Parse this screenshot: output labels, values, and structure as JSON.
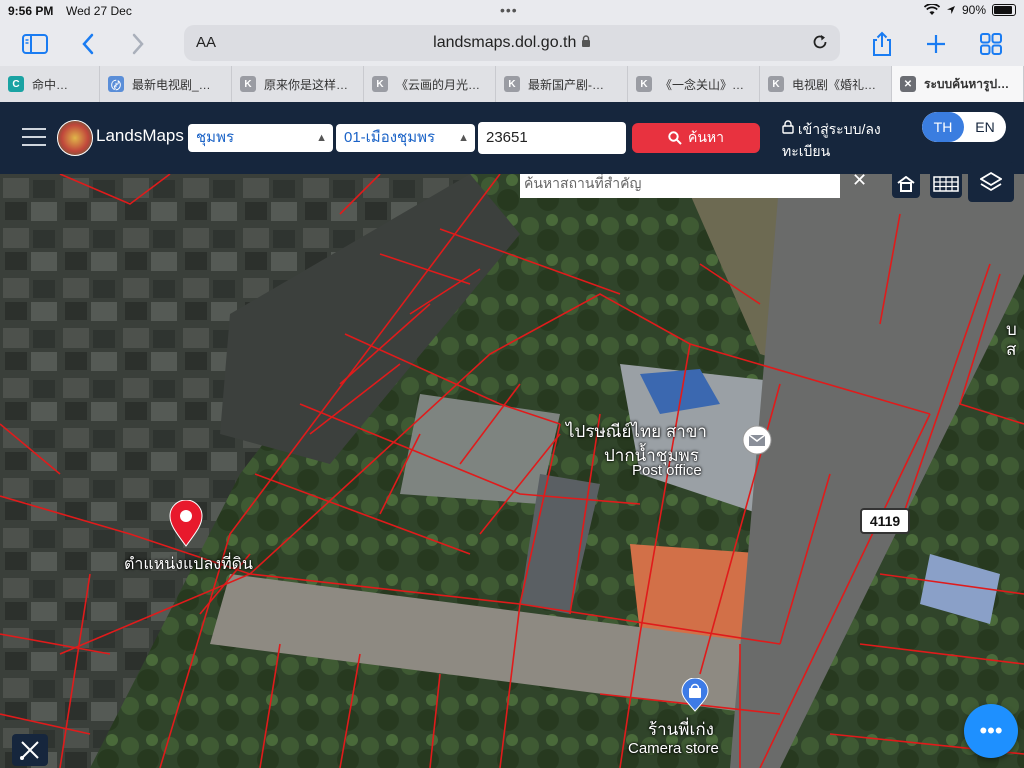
{
  "status_bar": {
    "time": "9:56 PM",
    "date": "Wed 27 Dec",
    "battery": "90%",
    "battery_level": 0.9
  },
  "browser": {
    "text_size_label": "AA",
    "url": "landsmaps.dol.go.th",
    "tabs": [
      {
        "icon": "C",
        "title": "命中…"
      },
      {
        "icon": "〄",
        "title": "最新电视剧_…"
      },
      {
        "icon": "K",
        "title": "原来你是这样…"
      },
      {
        "icon": "K",
        "title": "《云画的月光…"
      },
      {
        "icon": "K",
        "title": "最新国产剧-…"
      },
      {
        "icon": "K",
        "title": "《一念关山》…"
      },
      {
        "icon": "K",
        "title": "电视剧《婚礼…"
      },
      {
        "icon": "✕",
        "title": "ระบบค้นหารูป…"
      }
    ]
  },
  "app": {
    "brand": "LandsMaps",
    "province": "ชุมพร",
    "district": "01-เมืองชุมพร",
    "parcel_number": "23651",
    "search_label": "ค้นหา",
    "login_line1": "เข้าสู่ระบบ/ลง",
    "login_line2": "ทะเบียน",
    "lang_th": "TH",
    "lang_en": "EN"
  },
  "map": {
    "place_search_placeholder": "ค้นหาสถานที่สำคัญ",
    "parcel_marker_label": "ตำแหน่งแปลงที่ดิน",
    "post_office_th_1": "ไปรษณีย์ไทย สาขา",
    "post_office_th_2": "ปากน้ำชุมพร",
    "post_office_en": "Post office",
    "road_number": "4119",
    "shop_th": "ร้านพี่เก่ง",
    "shop_en": "Camera store",
    "edge_label_1": "บ",
    "edge_label_2": "ส"
  },
  "colors": {
    "nav_bg": "#16263d",
    "accent_red": "#e8323f",
    "parcel_line": "#e01b1b",
    "lang_active": "#3a7de0"
  },
  "icons": [
    "sidebar-icon",
    "back-icon",
    "forward-icon",
    "lock-icon",
    "reload-icon",
    "share-icon",
    "plus-icon",
    "tabs-grid-icon",
    "hamburger-icon",
    "search-icon",
    "user-lock-icon",
    "home-icon",
    "grid-icon",
    "layers-icon",
    "location-pin-icon",
    "mail-icon",
    "shopping-bag-icon",
    "more-icon",
    "ruler-tool-icon"
  ]
}
